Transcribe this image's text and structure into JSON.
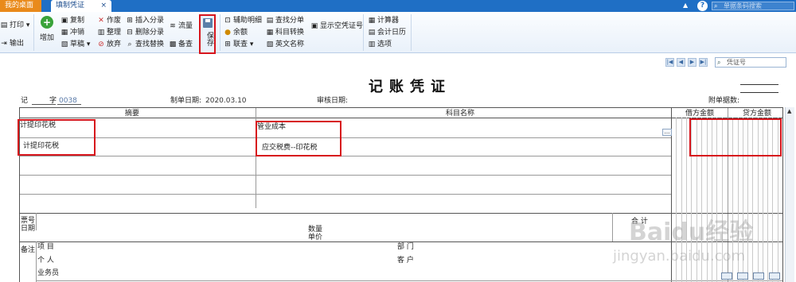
{
  "tabs": {
    "home": "我的桌面",
    "voucher": "填制凭证",
    "voucher_close": "×",
    "search_placeholder": "单据条码搜索",
    "help": "?"
  },
  "ribbon": {
    "print": "打印",
    "export": "输出",
    "add": "增加",
    "copy": "复制",
    "reverse": "冲销",
    "draft": "草稿",
    "void": "作废",
    "tidy": "整理",
    "discard": "放弃",
    "insert_entry": "插入分录",
    "delete_entry": "删除分录",
    "find_replace": "查找替换",
    "flow": "流量",
    "backup_check": "备查",
    "save": "保存",
    "aux_detail": "辅助明细",
    "balance": "余额",
    "linked_query": "联查",
    "find_split": "查找分单",
    "subject_convert": "科目转换",
    "english_name": "英文名称",
    "show_empty_no": "显示空凭证号",
    "calculator": "计算器",
    "accounting_calendar": "会计日历",
    "options": "选项"
  },
  "navigation": {
    "voucher_no_placeholder": "凭证号",
    "buttons": [
      "first",
      "prev",
      "next",
      "last"
    ]
  },
  "voucher": {
    "title": "记账凭证",
    "type_label": "记",
    "no_label": "字",
    "no_value": "0038",
    "date_label": "制单日期:",
    "date_value": "2020.03.10",
    "audit_date_label": "审核日期:",
    "attachment_label": "附单据数:",
    "columns": {
      "summary": "摘要",
      "subject": "科目名称",
      "debit": "借方金额",
      "credit": "贷方金额"
    },
    "rows": [
      {
        "summary": "计提印花税",
        "subject": "管业成本"
      },
      {
        "summary": "计提印花税",
        "subject": "应交税费--印花税"
      }
    ],
    "footer": {
      "ticket_no": "票号",
      "date": "日期",
      "quantity": "数量",
      "unit_price": "单价",
      "total": "合 计",
      "remarks": "备注",
      "project": "项 目",
      "individual": "个 人",
      "salesperson": "业务员",
      "department": "部 门",
      "customer": "客 户"
    }
  },
  "watermark": {
    "logo": "Baidu经验",
    "url": "jingyan.baidu.com"
  }
}
